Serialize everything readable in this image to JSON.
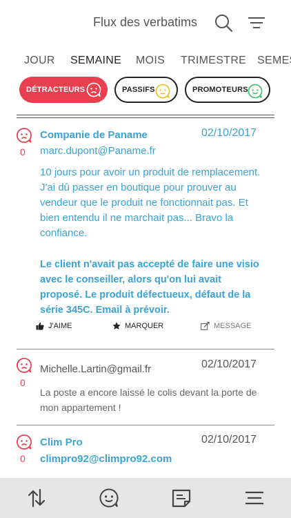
{
  "header": {
    "title": "Flux des verbatims",
    "search_icon": "search-icon",
    "filter_icon": "filter-lines-icon"
  },
  "tabs": [
    {
      "label": "JOUR",
      "active": false
    },
    {
      "label": "SEMAINE",
      "active": true
    },
    {
      "label": "MOIS",
      "active": false
    },
    {
      "label": "TRIMESTRE",
      "active": false
    },
    {
      "label": "SEMESTRE",
      "active": false
    }
  ],
  "filters": {
    "detractors": {
      "label": "DÉTRACTEURS",
      "icon": "sad-face-icon"
    },
    "passives": {
      "label": "PASSIFS",
      "icon": "neutral-face-icon"
    },
    "promoters": {
      "label": "PROMOTEURS",
      "icon": "happy-face-icon"
    }
  },
  "colors": {
    "accent_blue": "#3aa3d6",
    "detractor_red": "#e8404f",
    "passive_yellow": "#f2c12e",
    "promoter_green": "#4cc26b"
  },
  "feed": [
    {
      "company": "Companie de Paname",
      "email": "marc.dupont@Paname.fr",
      "date": "02/10/2017",
      "count": "0",
      "verbatim": "10 jours pour avoir un produit de remplacement. J'ai dû passer en boutique pour prouver au vendeur que le produit ne fonctionnait pas. Et bien entendu il ne marchait pas... Bravo la confiance.",
      "note": "Le client n'avait pas accepté de faire une visio avec le conseiller, alors qu'on lui avait proposé. Le produit défectueux, défaut de la série 345C. Email à prévoir.",
      "actions": {
        "like": "J'AIME",
        "mark": "MARQUER",
        "message": "MESSAGE"
      }
    },
    {
      "company": "",
      "email": "Michelle.Lartin@gmail.fr",
      "date": "02/10/2017",
      "count": "0",
      "verbatim": "La poste a encore laissé le colis devant la porte de mon appartement !"
    },
    {
      "company": "Clim Pro",
      "email": "climpro92@climpro92.com",
      "date": "02/10/2017",
      "count": "0"
    }
  ],
  "bottom_nav": [
    {
      "icon": "sort-arrows-icon"
    },
    {
      "icon": "smiley-icon"
    },
    {
      "icon": "document-icon"
    },
    {
      "icon": "menu-icon"
    }
  ]
}
